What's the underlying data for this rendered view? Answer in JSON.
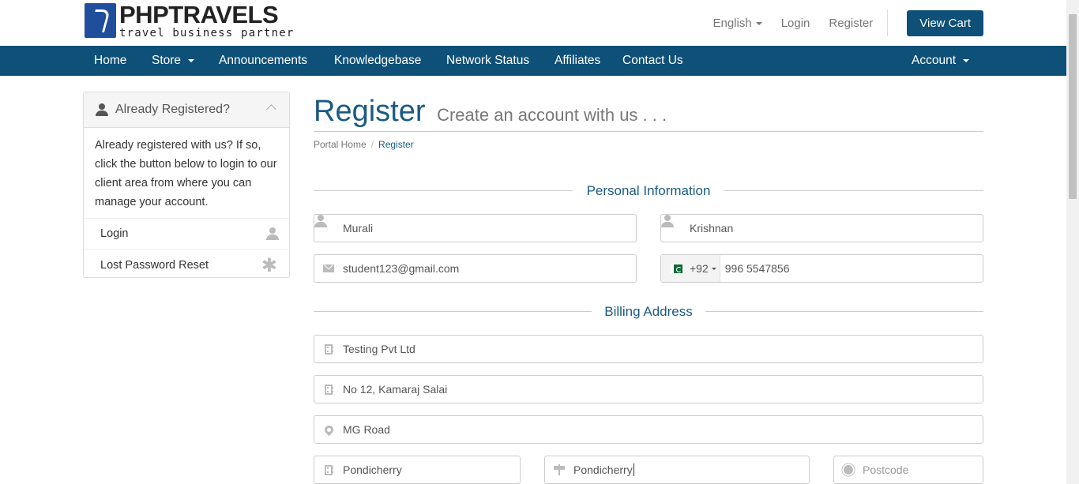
{
  "brand": {
    "title": "PHPTRAVELS",
    "subtitle": "travel business partner"
  },
  "top_links": {
    "language": "English",
    "login": "Login",
    "register": "Register",
    "cart": "View Cart"
  },
  "nav": {
    "home": "Home",
    "store": "Store",
    "announcements": "Announcements",
    "knowledgebase": "Knowledgebase",
    "network_status": "Network Status",
    "affiliates": "Affiliates",
    "contact": "Contact Us",
    "account": "Account"
  },
  "sidebar": {
    "title": "Already Registered?",
    "text": "Already registered with us? If so, click the button below to login to our client area from where you can manage your account.",
    "links": [
      {
        "label": "Login",
        "icon": "user-icon"
      },
      {
        "label": "Lost Password Reset",
        "icon": "asterisk-icon"
      }
    ]
  },
  "page": {
    "title": "Register",
    "subtitle": "Create an account with us . . ."
  },
  "breadcrumb": {
    "home": "Portal Home",
    "separator": "/",
    "current": "Register"
  },
  "sections": {
    "personal": "Personal Information",
    "billing": "Billing Address"
  },
  "form": {
    "first_name": "Murali",
    "last_name": "Krishnan",
    "email": "student123@gmail.com",
    "phone_code": "+92",
    "phone": "996 5547856",
    "company": "Testing Pvt Ltd",
    "address1": "No 12, Kamaraj Salai",
    "address2": "MG Road",
    "city": "Pondicherry",
    "state": "Pondicherry",
    "postcode_placeholder": "Postcode"
  },
  "colors": {
    "brand": "#0e5077",
    "accent": "#1a5a85"
  }
}
